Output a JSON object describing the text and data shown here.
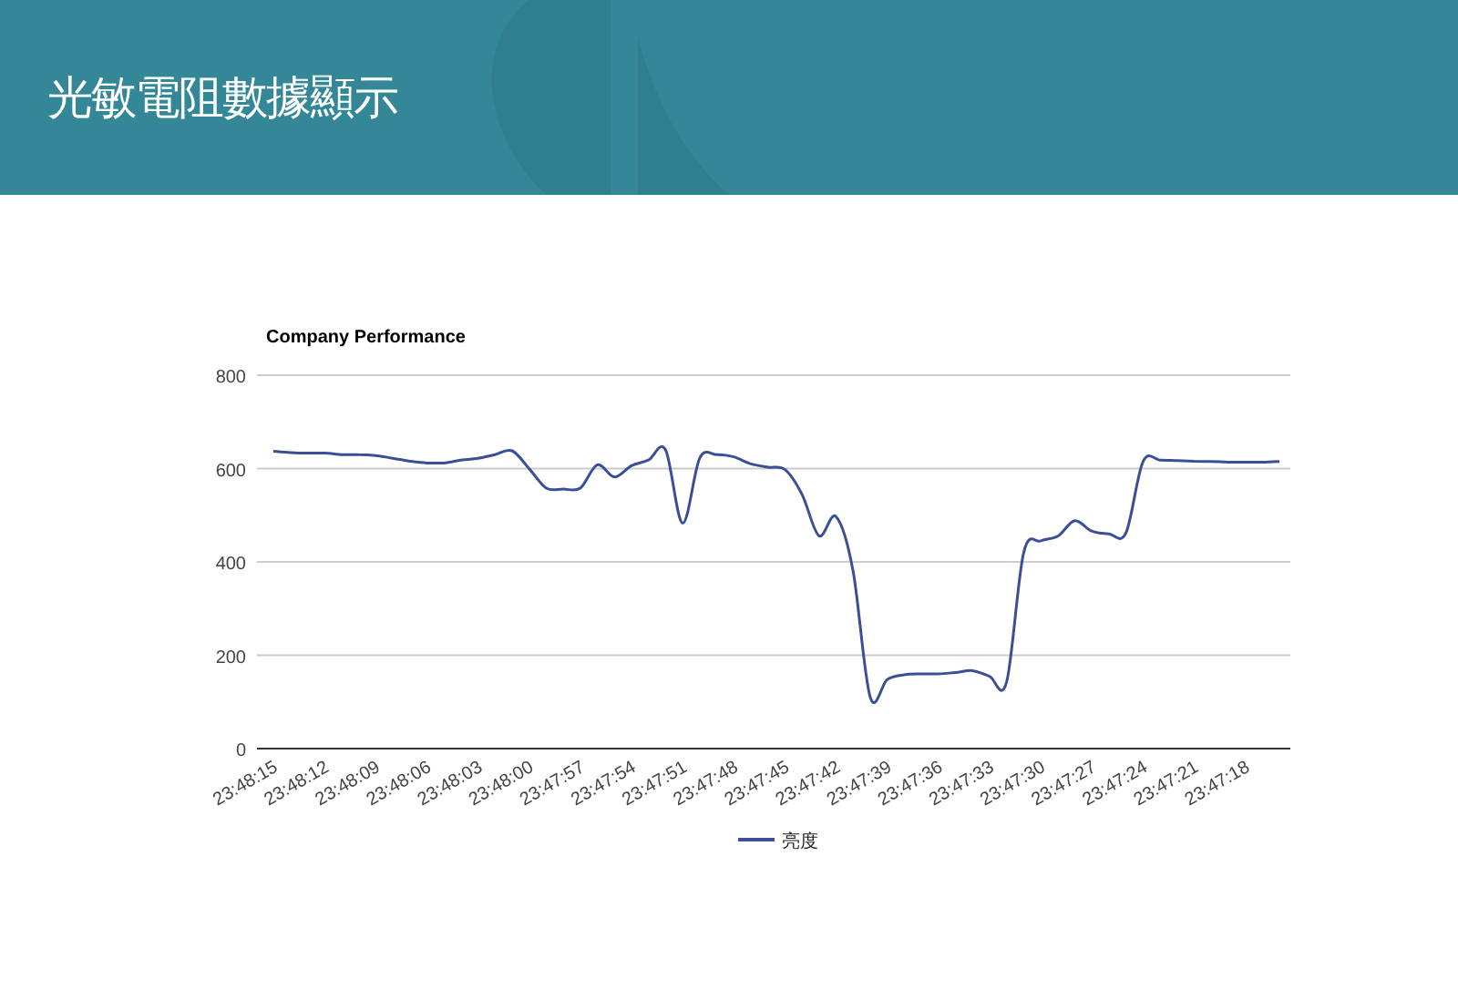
{
  "header": {
    "title": "光敏電阻數據顯示"
  },
  "chart": {
    "chart_data": {
      "type": "line",
      "title": "Company Performance",
      "categories": [
        "23:48:15",
        null,
        null,
        "23:48:12",
        null,
        null,
        "23:48:09",
        null,
        null,
        "23:48:06",
        null,
        null,
        "23:48:03",
        null,
        null,
        "23:48:00",
        null,
        null,
        "23:47:57",
        null,
        null,
        "23:47:54",
        null,
        null,
        "23:47:51",
        null,
        null,
        "23:47:48",
        null,
        null,
        "23:47:45",
        null,
        null,
        "23:47:42",
        null,
        null,
        "23:47:39",
        null,
        null,
        "23:47:36",
        null,
        null,
        "23:47:33",
        null,
        null,
        "23:47:30",
        null,
        null,
        "23:47:27",
        null,
        null,
        "23:47:24",
        null,
        null,
        "23:47:21",
        null,
        null,
        "23:47:18",
        null,
        null
      ],
      "grid": true,
      "ylim": [
        0,
        800
      ],
      "yticks": [
        0,
        200,
        400,
        600,
        800
      ],
      "series": [
        {
          "name": "亮度",
          "color": "#3b4f96",
          "values": [
            637,
            634,
            633,
            633,
            630,
            630,
            628,
            622,
            616,
            612,
            612,
            618,
            622,
            630,
            638,
            600,
            558,
            556,
            558,
            608,
            582,
            606,
            618,
            640,
            483,
            622,
            630,
            625,
            610,
            603,
            598,
            545,
            456,
            497,
            380,
            110,
            148,
            158,
            160,
            160,
            163,
            167,
            155,
            142,
            420,
            445,
            455,
            488,
            466,
            460,
            462,
            615,
            618,
            617,
            616,
            615,
            614,
            614,
            614,
            615
          ]
        }
      ]
    }
  }
}
